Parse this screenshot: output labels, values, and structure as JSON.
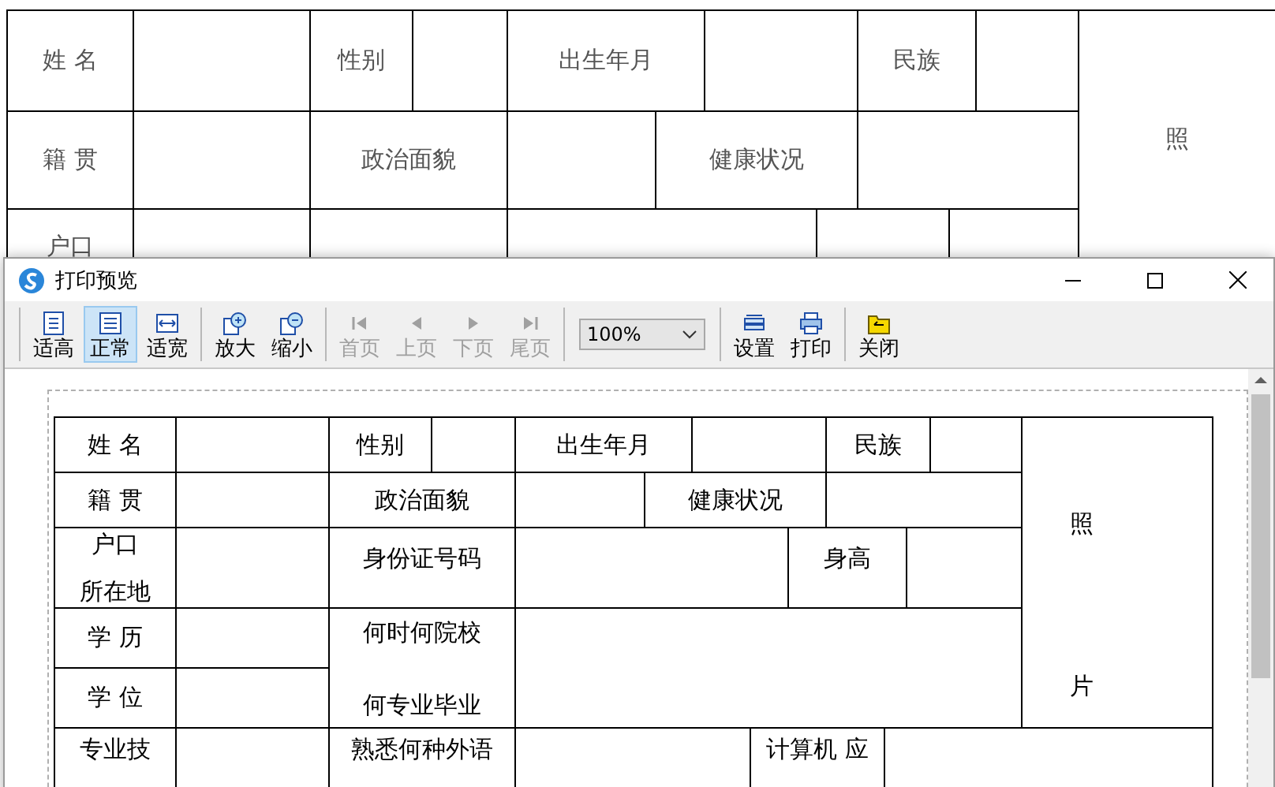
{
  "background_form": {
    "labels": [
      "姓 名",
      "性别",
      "出生年月",
      "民族",
      "照",
      "籍 贯",
      "政治面貌",
      "健康状况",
      "户口"
    ]
  },
  "dialog": {
    "title": "打印预览",
    "toolbar": {
      "groups": [
        {
          "kind": "buttons",
          "items": [
            {
              "label": "适高",
              "selected": false,
              "disabled": false
            },
            {
              "label": "正常",
              "selected": true,
              "disabled": false
            },
            {
              "label": "适宽",
              "selected": false,
              "disabled": false
            }
          ]
        },
        {
          "kind": "buttons",
          "items": [
            {
              "label": "放大",
              "selected": false,
              "disabled": false
            },
            {
              "label": "缩小",
              "selected": false,
              "disabled": false
            }
          ]
        },
        {
          "kind": "buttons",
          "items": [
            {
              "label": "首页",
              "selected": false,
              "disabled": true
            },
            {
              "label": "上页",
              "selected": false,
              "disabled": true
            },
            {
              "label": "下页",
              "selected": false,
              "disabled": true
            },
            {
              "label": "尾页",
              "selected": false,
              "disabled": true
            }
          ]
        },
        {
          "kind": "select",
          "value": "100%"
        },
        {
          "kind": "buttons",
          "items": [
            {
              "label": "设置",
              "selected": false,
              "disabled": false
            },
            {
              "label": "打印",
              "selected": false,
              "disabled": false
            }
          ]
        },
        {
          "kind": "buttons",
          "items": [
            {
              "label": "关闭",
              "selected": false,
              "disabled": false
            }
          ]
        }
      ]
    },
    "form": {
      "labels": [
        "姓 名",
        "性别",
        "出生年月",
        "民族",
        "照",
        "片",
        "籍 贯",
        "政治面貌",
        "健康状况",
        "户口",
        "所在地",
        "身份证号码",
        "身高",
        "学 历",
        "何时何院校",
        "何专业毕业",
        "学 位",
        "专业技",
        "熟悉何种外语",
        "计算机 应"
      ]
    }
  }
}
